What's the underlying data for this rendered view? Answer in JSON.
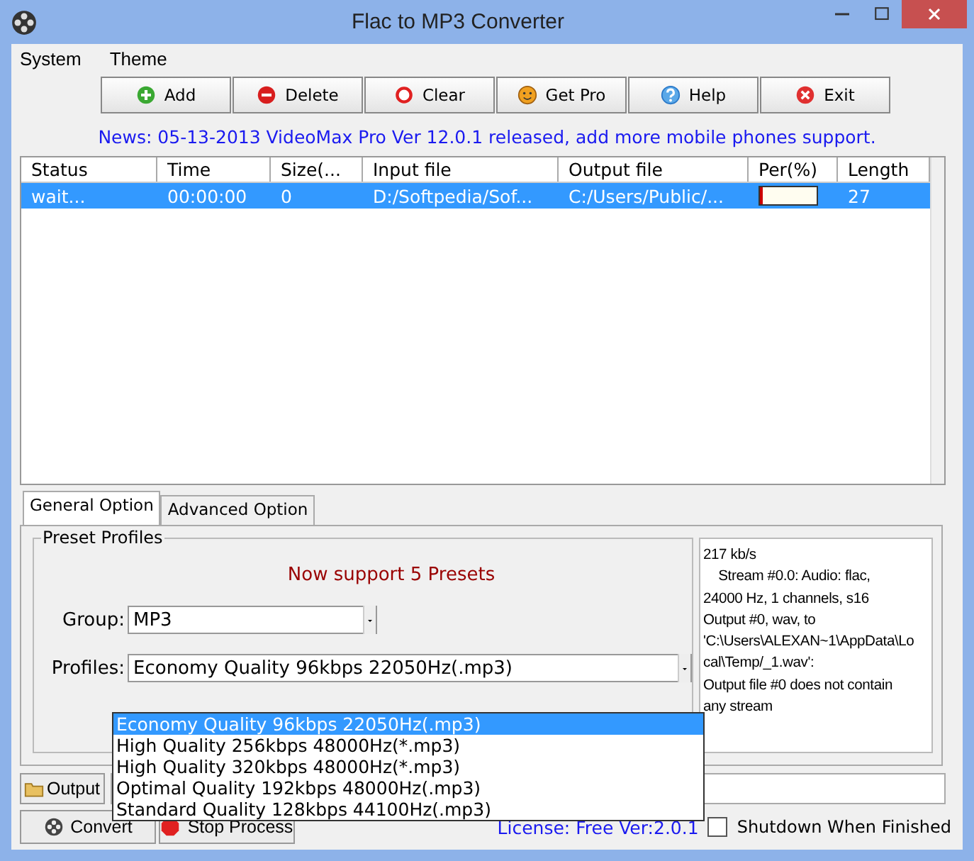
{
  "window": {
    "title": "Flac to MP3 Converter"
  },
  "menu": [
    "System",
    "Theme"
  ],
  "toolbar": [
    {
      "label": "Add",
      "kind": "add"
    },
    {
      "label": "Delete",
      "kind": "delete"
    },
    {
      "label": "Clear",
      "kind": "clear"
    },
    {
      "label": "Get Pro",
      "kind": "pro"
    },
    {
      "label": "Help",
      "kind": "help"
    },
    {
      "label": "Exit",
      "kind": "exit"
    }
  ],
  "news": "News: 05-13-2013 VideoMax Pro Ver 12.0.1 released, add more mobile phones support.",
  "table": {
    "columns": [
      "Status",
      "Time",
      "Size(...",
      "Input file",
      "Output file",
      "Per(%)",
      "Length"
    ],
    "rows": [
      {
        "selected": true,
        "status": "wait...",
        "time": "00:00:00",
        "size": "0",
        "input": "D:/Softpedia/Sof...",
        "output": "C:/Users/Public/...",
        "level": 0.05,
        "length": "27"
      }
    ]
  },
  "tabs": [
    {
      "label": "General Option",
      "selected": true
    },
    {
      "label": "Advanced Option",
      "selected": false
    }
  ],
  "preset": {
    "legend": "Preset Profiles",
    "notice": "Now support 5 Presets",
    "group_label": "Group:",
    "group_value": "MP3",
    "profiles_label": "Profiles:",
    "profiles_value": "Economy Quality 96kbps 22050Hz(.mp3)",
    "options": [
      {
        "label": "Economy Quality 96kbps 22050Hz(.mp3)",
        "selected": true
      },
      {
        "label": "High Quality 256kbps 48000Hz(*.mp3)",
        "selected": false
      },
      {
        "label": "High Quality 320kbps 48000Hz(*.mp3)",
        "selected": false
      },
      {
        "label": "Optimal Quality 192kbps 48000Hz(.mp3)",
        "selected": false
      },
      {
        "label": "Standard Quality 128kbps 44100Hz(.mp3)",
        "selected": false
      }
    ]
  },
  "log": [
    "217 kb/s",
    "    Stream #0.0: Audio: flac,",
    "24000 Hz, 1 channels, s16",
    "Output #0, wav, to",
    "'C:\\Users\\ALEXAN~1\\AppData\\Lo",
    "cal\\Temp/_1.wav':",
    "Output file #0 does not contain",
    "any stream"
  ],
  "output_button": "Output",
  "convert_button": "Convert",
  "stop_button": "Stop Process",
  "license": "License: Free Ver:2.0.1",
  "shutdown": {
    "label": "Shutdown When Finished",
    "checked": false
  }
}
